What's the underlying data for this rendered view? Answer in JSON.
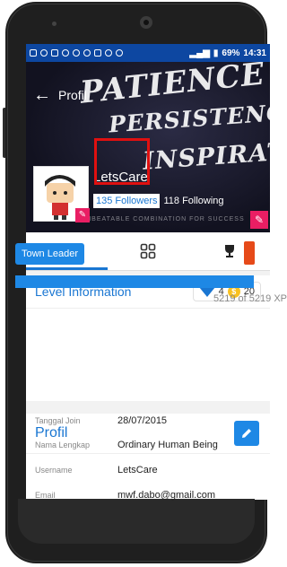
{
  "status_bar": {
    "battery": "69%",
    "time": "14:31"
  },
  "header": {
    "title": "Profil",
    "back_icon": "arrow-left-icon"
  },
  "cover": {
    "quote_lines": [
      "PATIENCE",
      "PERSISTENCE",
      "INSPIRATION"
    ],
    "tagline": "MAKE AN UNBEATABLE COMBINATION FOR SUCCESS"
  },
  "profile": {
    "username": "LetsCare",
    "followers": "135 Followers",
    "following": "118 Following"
  },
  "tabs": [
    {
      "icon": "person-icon"
    },
    {
      "icon": "grid-icon"
    },
    {
      "icon": "trophy-icon"
    }
  ],
  "level": {
    "title": "Level Information",
    "gems": "4",
    "coins": "20",
    "rank": "Town Leader",
    "xp_text": "5219 of 5219 XP",
    "xp_fraction": 1.0
  },
  "profil": {
    "title": "Profil",
    "rows": [
      {
        "label": "Tanggal Join",
        "value": "28/07/2015"
      },
      {
        "label": "Nama Lengkap",
        "value": "Ordinary Human Being"
      },
      {
        "label": "Username",
        "value": "LetsCare"
      },
      {
        "label": "Email",
        "value": "mwf.dabo@gmail.com"
      }
    ]
  },
  "colors": {
    "accent": "#1976d2",
    "highlight": "#e01010",
    "pink": "#e91e63",
    "statusbar": "#0d47a1"
  }
}
